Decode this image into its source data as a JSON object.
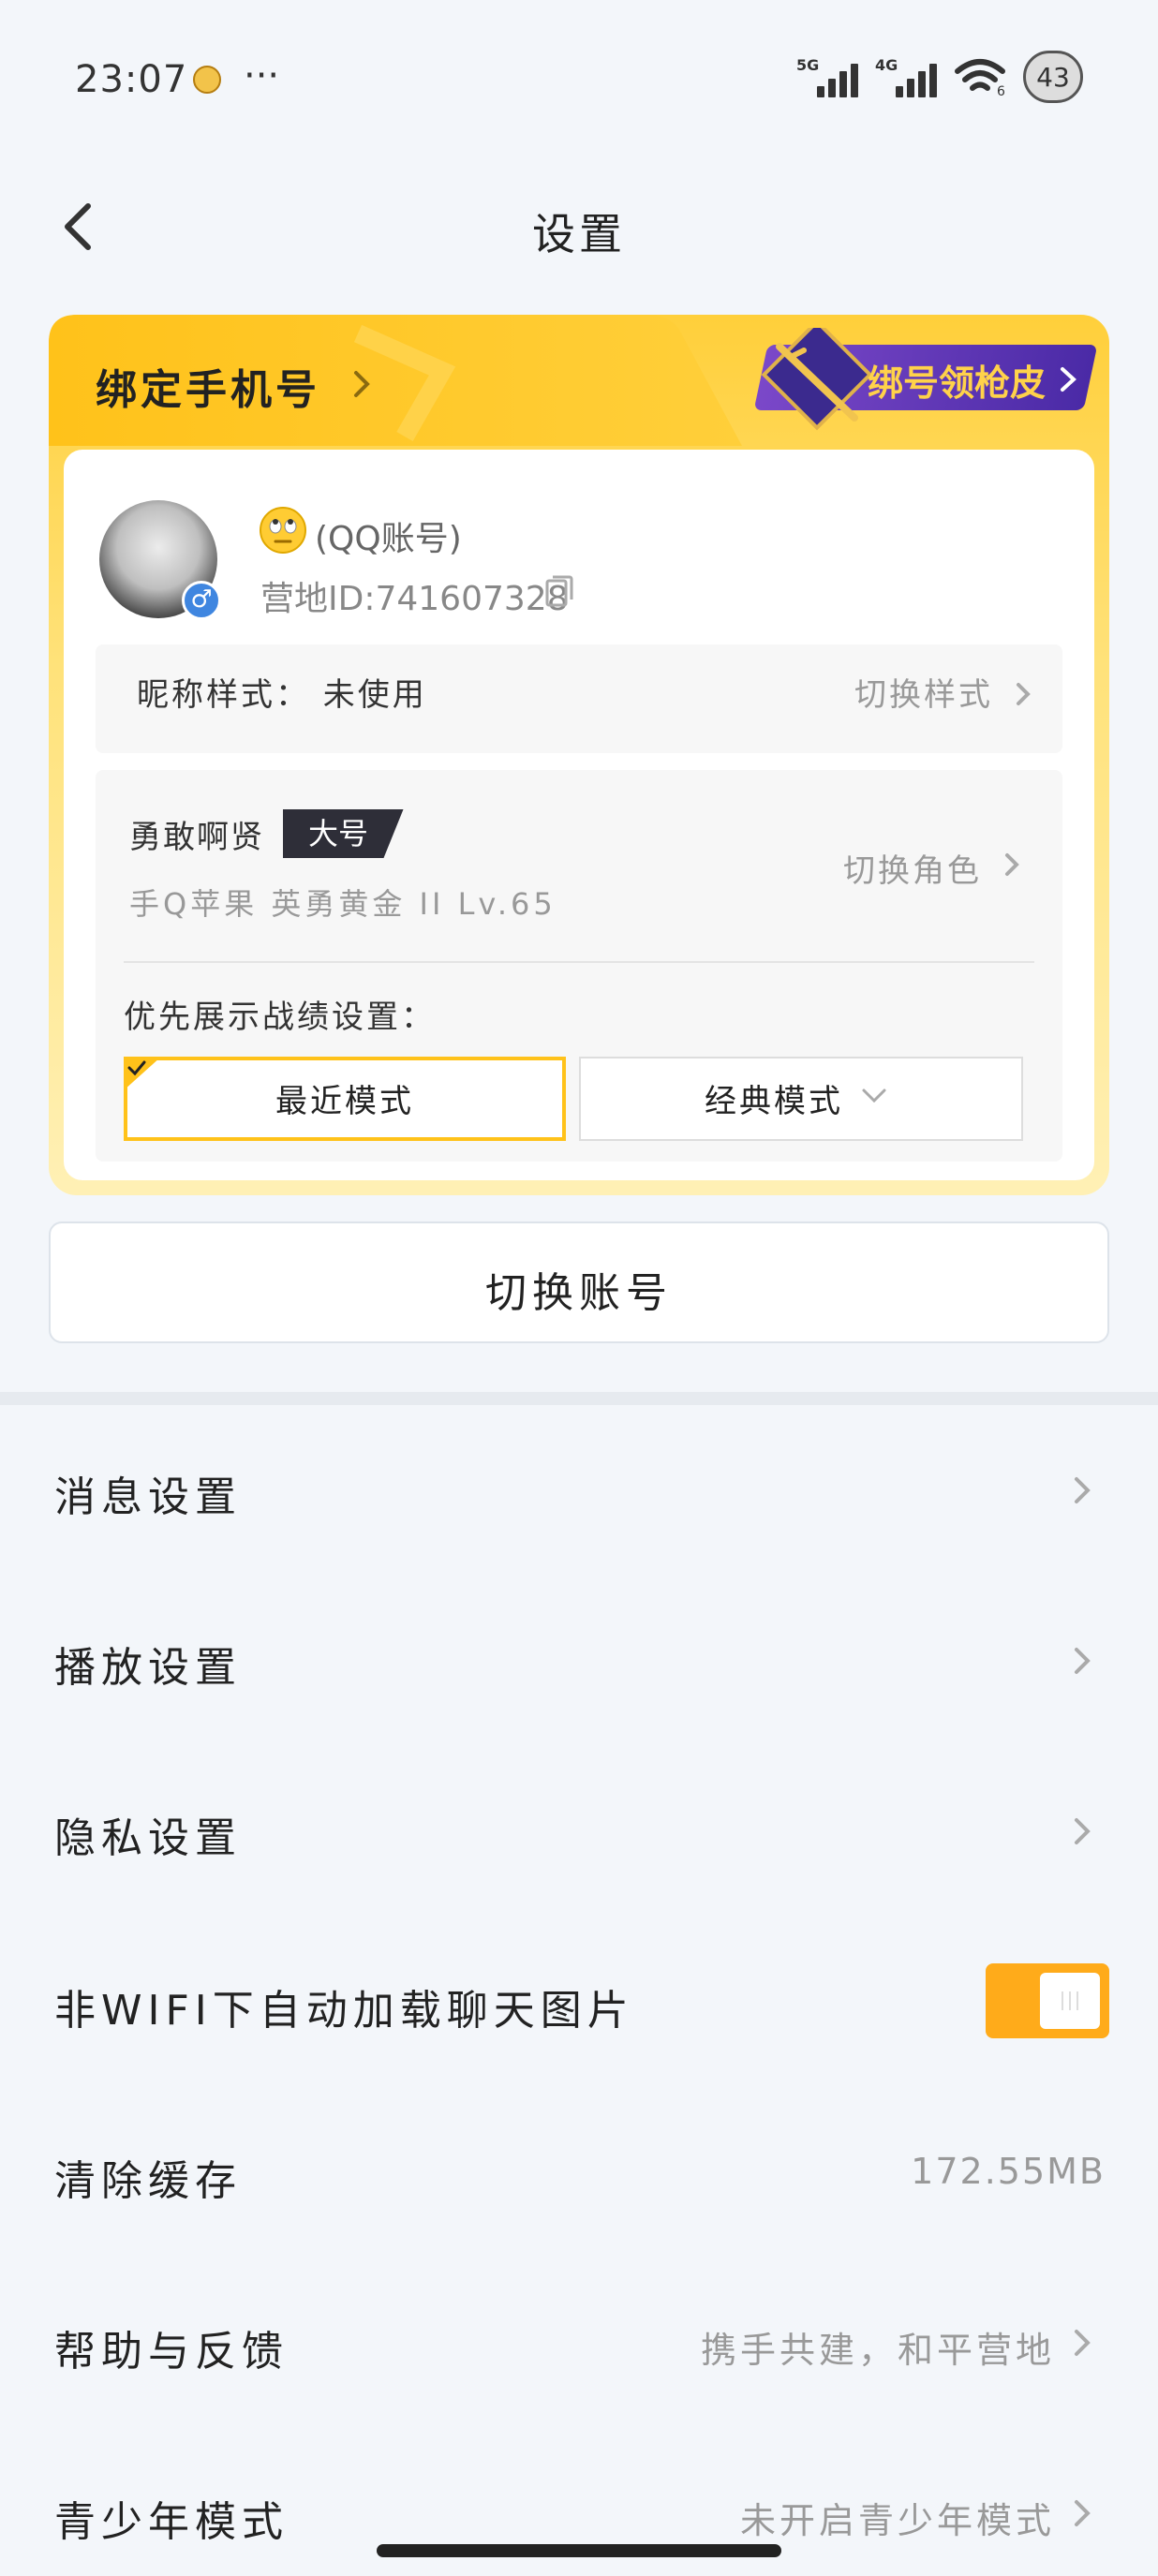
{
  "status_bar": {
    "time": "23:07",
    "more": "···",
    "signal1_label": "5G",
    "signal2_label": "4G",
    "wifi_label": "6",
    "battery": "43"
  },
  "header": {
    "title": "设置"
  },
  "account_card": {
    "bind_phone": "绑定手机号",
    "promo": "绑号领枪皮",
    "account_type": "(QQ账号)",
    "camp_id": "营地ID:741607328",
    "nickname_style_label": "昵称样式：  未使用",
    "nickname_switch": "切换样式",
    "role_name": "勇敢啊贤",
    "role_tag": "大号",
    "role_sub": "手Q苹果  英勇黄金 II  Lv.65",
    "role_switch": "切换角色",
    "pref_label": "优先展示战绩设置：",
    "mode_recent": "最近模式",
    "mode_classic": "经典模式"
  },
  "switch_account": "切换账号",
  "settings": [
    {
      "label": "消息设置"
    },
    {
      "label": "播放设置"
    },
    {
      "label": "隐私设置"
    },
    {
      "label": "非WIFI下自动加载聊天图片",
      "toggle_on": true
    },
    {
      "label": "清除缓存",
      "value": "172.55MB"
    },
    {
      "label": "帮助与反馈",
      "value": "携手共建，和平营地"
    },
    {
      "label": "青少年模式",
      "value": "未开启青少年模式"
    }
  ],
  "colors": {
    "accent": "#ffc21a",
    "toggle": "#ffab1a",
    "promo_bg": "#5a34b8",
    "promo_text": "#ffd24a"
  }
}
